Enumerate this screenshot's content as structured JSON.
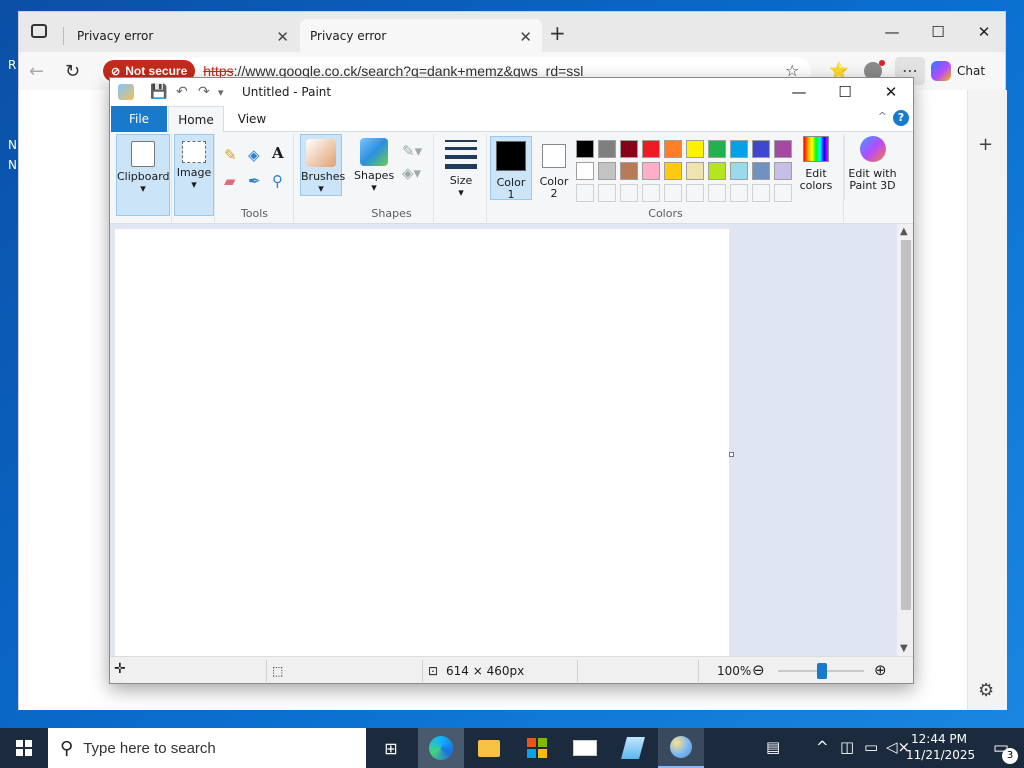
{
  "desktop": {
    "frag_r": "R",
    "frag_n1": "N",
    "frag_n2": "N"
  },
  "browser": {
    "tabs": [
      {
        "label": "Privacy error",
        "close": "✕"
      },
      {
        "label": "Privacy error",
        "close": "✕"
      }
    ],
    "new_tab": "+",
    "window_controls": {
      "minimize": "—",
      "maximize": "☐",
      "close": "✕"
    },
    "nav": {
      "back": "←",
      "refresh": "↻"
    },
    "security_badge": "Not secure",
    "url_scheme": "https",
    "url_rest": "://www.google.co.ck/search?q=dank+memz&gws_rd=ssl",
    "toolbar_icons": {
      "favorite": "☆",
      "collections": "⭐",
      "more": "⋯"
    },
    "chat_label": "Chat",
    "rail": {
      "add": "+",
      "settings": "⚙"
    }
  },
  "paint": {
    "title": "Untitled - Paint",
    "qa": {
      "save": "💾",
      "undo": "↶",
      "redo": "↷",
      "customize": "▾"
    },
    "window_controls": {
      "minimize": "—",
      "maximize": "☐",
      "close": "✕"
    },
    "tabs": {
      "file": "File",
      "home": "Home",
      "view": "View"
    },
    "help": "?",
    "collapse": "^",
    "ribbon": {
      "clipboard": "Clipboard",
      "image": "Image",
      "tools_label": "Tools",
      "brushes": "Brushes",
      "shapes_btn": "Shapes",
      "shapes_label": "Shapes",
      "size": "Size",
      "color1": "Color",
      "color1_n": "1",
      "color2": "Color",
      "color2_n": "2",
      "colors_label": "Colors",
      "edit_colors": "Edit",
      "edit_colors2": "colors",
      "edit3d": "Edit with",
      "edit3d2": "Paint 3D",
      "palette_row1": [
        "#000000",
        "#7f7f7f",
        "#880015",
        "#ed1c24",
        "#ff7f27",
        "#fff200",
        "#22b14c",
        "#00a2e8",
        "#3f48cc",
        "#a349a4"
      ],
      "palette_row2": [
        "#ffffff",
        "#c3c3c3",
        "#b97a57",
        "#ffaec9",
        "#ffc90e",
        "#efe4b0",
        "#b5e61d",
        "#99d9ea",
        "#7092be",
        "#c8bfe7"
      ],
      "color1_value": "#000000",
      "color2_value": "#ffffff"
    },
    "status": {
      "canvas_size": "614 × 460px",
      "zoom": "100%"
    }
  },
  "taskbar": {
    "search_placeholder": "Type here to search",
    "clock_time": "12:44 PM",
    "clock_date": "11/21/2025",
    "notif_count": "3"
  }
}
